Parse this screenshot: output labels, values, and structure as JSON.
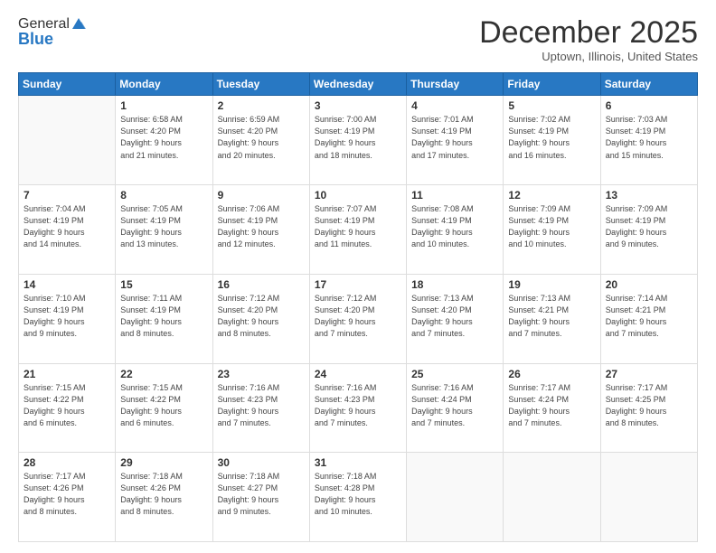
{
  "header": {
    "logo_general": "General",
    "logo_blue": "Blue",
    "month_title": "December 2025",
    "location": "Uptown, Illinois, United States"
  },
  "weekdays": [
    "Sunday",
    "Monday",
    "Tuesday",
    "Wednesday",
    "Thursday",
    "Friday",
    "Saturday"
  ],
  "weeks": [
    [
      {
        "day": "",
        "info": ""
      },
      {
        "day": "1",
        "info": "Sunrise: 6:58 AM\nSunset: 4:20 PM\nDaylight: 9 hours\nand 21 minutes."
      },
      {
        "day": "2",
        "info": "Sunrise: 6:59 AM\nSunset: 4:20 PM\nDaylight: 9 hours\nand 20 minutes."
      },
      {
        "day": "3",
        "info": "Sunrise: 7:00 AM\nSunset: 4:19 PM\nDaylight: 9 hours\nand 18 minutes."
      },
      {
        "day": "4",
        "info": "Sunrise: 7:01 AM\nSunset: 4:19 PM\nDaylight: 9 hours\nand 17 minutes."
      },
      {
        "day": "5",
        "info": "Sunrise: 7:02 AM\nSunset: 4:19 PM\nDaylight: 9 hours\nand 16 minutes."
      },
      {
        "day": "6",
        "info": "Sunrise: 7:03 AM\nSunset: 4:19 PM\nDaylight: 9 hours\nand 15 minutes."
      }
    ],
    [
      {
        "day": "7",
        "info": "Sunrise: 7:04 AM\nSunset: 4:19 PM\nDaylight: 9 hours\nand 14 minutes."
      },
      {
        "day": "8",
        "info": "Sunrise: 7:05 AM\nSunset: 4:19 PM\nDaylight: 9 hours\nand 13 minutes."
      },
      {
        "day": "9",
        "info": "Sunrise: 7:06 AM\nSunset: 4:19 PM\nDaylight: 9 hours\nand 12 minutes."
      },
      {
        "day": "10",
        "info": "Sunrise: 7:07 AM\nSunset: 4:19 PM\nDaylight: 9 hours\nand 11 minutes."
      },
      {
        "day": "11",
        "info": "Sunrise: 7:08 AM\nSunset: 4:19 PM\nDaylight: 9 hours\nand 10 minutes."
      },
      {
        "day": "12",
        "info": "Sunrise: 7:09 AM\nSunset: 4:19 PM\nDaylight: 9 hours\nand 10 minutes."
      },
      {
        "day": "13",
        "info": "Sunrise: 7:09 AM\nSunset: 4:19 PM\nDaylight: 9 hours\nand 9 minutes."
      }
    ],
    [
      {
        "day": "14",
        "info": "Sunrise: 7:10 AM\nSunset: 4:19 PM\nDaylight: 9 hours\nand 9 minutes."
      },
      {
        "day": "15",
        "info": "Sunrise: 7:11 AM\nSunset: 4:19 PM\nDaylight: 9 hours\nand 8 minutes."
      },
      {
        "day": "16",
        "info": "Sunrise: 7:12 AM\nSunset: 4:20 PM\nDaylight: 9 hours\nand 8 minutes."
      },
      {
        "day": "17",
        "info": "Sunrise: 7:12 AM\nSunset: 4:20 PM\nDaylight: 9 hours\nand 7 minutes."
      },
      {
        "day": "18",
        "info": "Sunrise: 7:13 AM\nSunset: 4:20 PM\nDaylight: 9 hours\nand 7 minutes."
      },
      {
        "day": "19",
        "info": "Sunrise: 7:13 AM\nSunset: 4:21 PM\nDaylight: 9 hours\nand 7 minutes."
      },
      {
        "day": "20",
        "info": "Sunrise: 7:14 AM\nSunset: 4:21 PM\nDaylight: 9 hours\nand 7 minutes."
      }
    ],
    [
      {
        "day": "21",
        "info": "Sunrise: 7:15 AM\nSunset: 4:22 PM\nDaylight: 9 hours\nand 6 minutes."
      },
      {
        "day": "22",
        "info": "Sunrise: 7:15 AM\nSunset: 4:22 PM\nDaylight: 9 hours\nand 6 minutes."
      },
      {
        "day": "23",
        "info": "Sunrise: 7:16 AM\nSunset: 4:23 PM\nDaylight: 9 hours\nand 7 minutes."
      },
      {
        "day": "24",
        "info": "Sunrise: 7:16 AM\nSunset: 4:23 PM\nDaylight: 9 hours\nand 7 minutes."
      },
      {
        "day": "25",
        "info": "Sunrise: 7:16 AM\nSunset: 4:24 PM\nDaylight: 9 hours\nand 7 minutes."
      },
      {
        "day": "26",
        "info": "Sunrise: 7:17 AM\nSunset: 4:24 PM\nDaylight: 9 hours\nand 7 minutes."
      },
      {
        "day": "27",
        "info": "Sunrise: 7:17 AM\nSunset: 4:25 PM\nDaylight: 9 hours\nand 8 minutes."
      }
    ],
    [
      {
        "day": "28",
        "info": "Sunrise: 7:17 AM\nSunset: 4:26 PM\nDaylight: 9 hours\nand 8 minutes."
      },
      {
        "day": "29",
        "info": "Sunrise: 7:18 AM\nSunset: 4:26 PM\nDaylight: 9 hours\nand 8 minutes."
      },
      {
        "day": "30",
        "info": "Sunrise: 7:18 AM\nSunset: 4:27 PM\nDaylight: 9 hours\nand 9 minutes."
      },
      {
        "day": "31",
        "info": "Sunrise: 7:18 AM\nSunset: 4:28 PM\nDaylight: 9 hours\nand 10 minutes."
      },
      {
        "day": "",
        "info": ""
      },
      {
        "day": "",
        "info": ""
      },
      {
        "day": "",
        "info": ""
      }
    ]
  ]
}
